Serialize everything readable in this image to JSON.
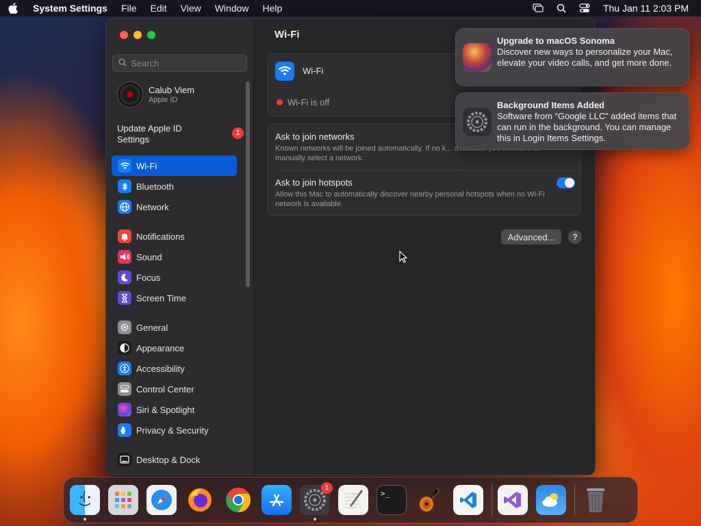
{
  "menubar": {
    "app_name": "System Settings",
    "menus": [
      "File",
      "Edit",
      "View",
      "Window",
      "Help"
    ],
    "clock": "Thu Jan 11  2:03 PM"
  },
  "sidebar": {
    "search_placeholder": "Search",
    "account": {
      "name": "Calub Viem",
      "subtitle": "Apple ID"
    },
    "update": {
      "label": "Update Apple ID Settings",
      "badge": "1"
    },
    "items": [
      {
        "label": "Wi-Fi",
        "icon": "wifi-icon",
        "color": "#1a7cf5",
        "active": true
      },
      {
        "label": "Bluetooth",
        "icon": "bluetooth-icon",
        "color": "#1a7cf5"
      },
      {
        "label": "Network",
        "icon": "globe-icon",
        "color": "#1a7cf5"
      },
      {
        "label": "Notifications",
        "icon": "bell-icon",
        "color": "#e9453a"
      },
      {
        "label": "Sound",
        "icon": "speaker-icon",
        "color": "#e2345e"
      },
      {
        "label": "Focus",
        "icon": "moon-icon",
        "color": "#5b4fd6"
      },
      {
        "label": "Screen Time",
        "icon": "hourglass-icon",
        "color": "#5b4fd6"
      },
      {
        "label": "General",
        "icon": "gear-icon",
        "color": "#8e8e93"
      },
      {
        "label": "Appearance",
        "icon": "appearance-icon",
        "color": "#1c1c1e"
      },
      {
        "label": "Accessibility",
        "icon": "accessibility-icon",
        "color": "#1a7cf5"
      },
      {
        "label": "Control Center",
        "icon": "control-center-icon",
        "color": "#8e8e93"
      },
      {
        "label": "Siri & Spotlight",
        "icon": "siri-icon",
        "color": "#8a3dd6"
      },
      {
        "label": "Privacy & Security",
        "icon": "hand-icon",
        "color": "#1a7cf5"
      },
      {
        "label": "Desktop & Dock",
        "icon": "desktop-icon",
        "color": "#1c1c1e"
      }
    ]
  },
  "main": {
    "title": "Wi-Fi",
    "wifi_label": "Wi-Fi",
    "status": "Wi-Fi is off",
    "ask_networks": {
      "title": "Ask to join networks",
      "desc": "Known networks will be joined automatically. If no k... available, you will have to manually select a network."
    },
    "ask_hotspots": {
      "title": "Ask to join hotspots",
      "desc": "Allow this Mac to automatically discover nearby personal hotspots when no Wi-Fi network is available.",
      "enabled": true
    },
    "advanced_label": "Advanced...",
    "help_label": "?"
  },
  "notifications": [
    {
      "title": "Upgrade to macOS Sonoma",
      "body": "Discover new ways to personalize your Mac, elevate your video calls, and get more done."
    },
    {
      "title": "Background Items Added",
      "body": "Software from “Google LLC” added items that can run in the background. You can manage this in Login Items Settings."
    }
  ],
  "dock": {
    "apps": [
      "Finder",
      "Launchpad",
      "Safari",
      "Firefox",
      "Chrome",
      "App Store",
      "System Settings",
      "TextEdit",
      "Terminal",
      "GarageBand",
      "Visual Studio Code"
    ],
    "system_settings_badge": "1",
    "terminal_prompt": ">_"
  }
}
